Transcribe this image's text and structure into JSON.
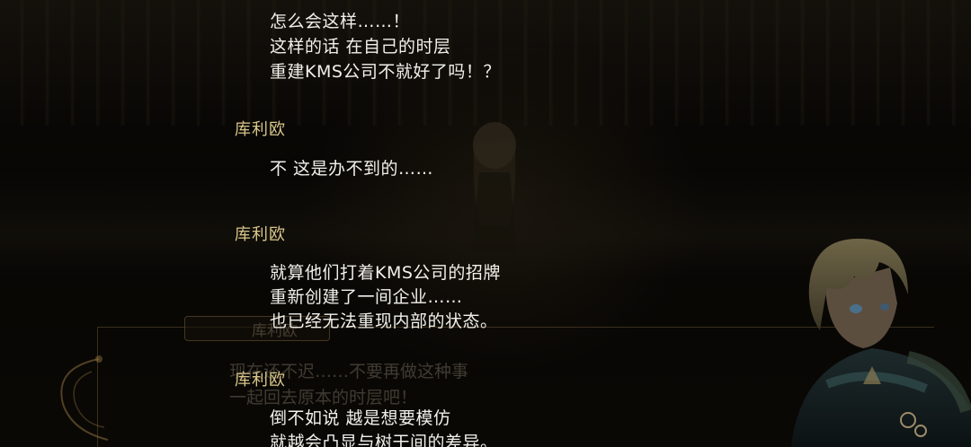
{
  "dialogue_log": [
    {
      "speaker": "",
      "lines": [
        "怎么会这样……！",
        "这样的话 在自己的时层",
        "重建KMS公司不就好了吗！？"
      ]
    },
    {
      "speaker": "库利欧",
      "lines": [
        "不 这是办不到的……"
      ]
    },
    {
      "speaker": "库利欧",
      "lines": [
        "就算他们打着KMS公司的招牌",
        "重新创建了一间企业……",
        "也已经无法重现内部的状态。"
      ]
    },
    {
      "speaker": "库利欧",
      "lines": [
        "倒不如说 越是想要模仿",
        "就越会凸显与树干间的差异。"
      ]
    }
  ],
  "background_dialog": {
    "speaker": "库利欧",
    "lines": [
      "现在还不迟……不要再做这种事",
      "一起回去原本的时层吧！"
    ]
  }
}
